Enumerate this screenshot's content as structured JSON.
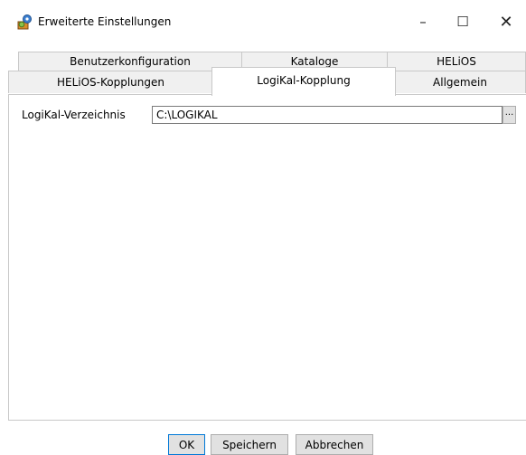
{
  "window": {
    "title": "Erweiterte Einstellungen",
    "app_icon": "settings-gears-icon",
    "minimize": "–",
    "maximize": "☐",
    "close": "✕"
  },
  "tabs": {
    "row1": [
      {
        "label": "Benutzerkonfiguration",
        "active": false
      },
      {
        "label": "Kataloge",
        "active": false
      },
      {
        "label": "HELiOS",
        "active": false
      }
    ],
    "row2": [
      {
        "label": "HELiOS-Kopplungen",
        "active": false
      },
      {
        "label": "LogiKal-Kopplung",
        "active": true
      },
      {
        "label": "Allgemein",
        "active": false
      }
    ]
  },
  "panel": {
    "field_label": "LogiKal-Verzeichnis",
    "field_value": "C:\\LOGIKAL",
    "browse_label": "..."
  },
  "buttons": {
    "ok": "OK",
    "save": "Speichern",
    "cancel": "Abbrechen"
  },
  "colors": {
    "accent": "#0078d7",
    "tab_inactive": "#f0f0f0",
    "border": "#c8c8c8"
  }
}
